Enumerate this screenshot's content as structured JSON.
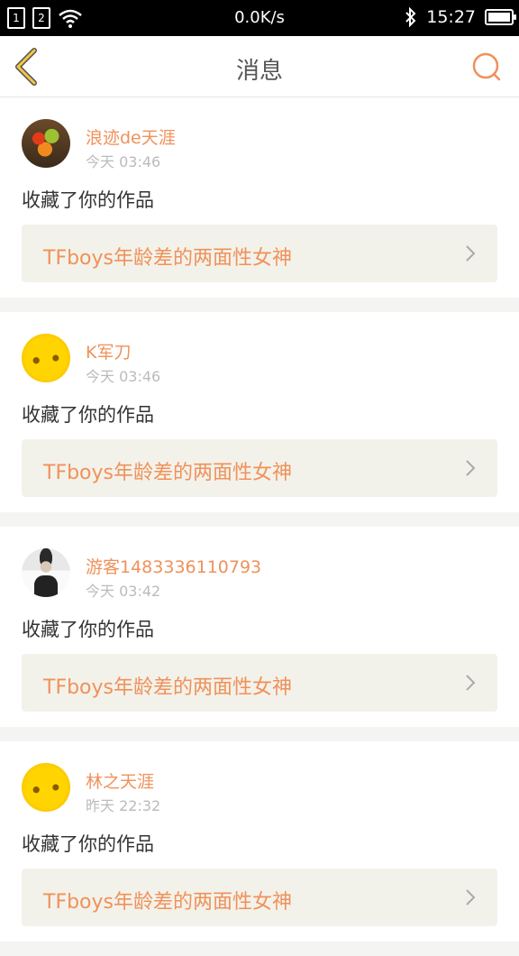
{
  "status_bar": {
    "sim1": "1",
    "sim2": "2",
    "network_speed": "0.0K/s",
    "time": "15:27",
    "icons": [
      "sim-card-icon",
      "wifi-icon",
      "bluetooth-icon",
      "battery-icon"
    ]
  },
  "nav": {
    "title": "消息",
    "back_icon": "chevron-left-icon",
    "search_icon": "search-icon"
  },
  "colors": {
    "accent": "#f0915a",
    "back_icon": "#f5c842"
  },
  "messages": [
    {
      "username": "浪迹de天涯",
      "time": "今天 03:46",
      "action": "收藏了你的作品",
      "work": "TFboys年龄差的两面性女神",
      "avatar": "autumn-leaves-avatar"
    },
    {
      "username": "K军刀",
      "time": "今天 03:46",
      "action": "收藏了你的作品",
      "work": "TFboys年龄差的两面性女神",
      "avatar": "sunflower-avatar"
    },
    {
      "username": "游客1483336110793",
      "time": "今天 03:42",
      "action": "收藏了你的作品",
      "work": "TFboys年龄差的两面性女神",
      "avatar": "person-avatar"
    },
    {
      "username": "林之天涯",
      "time": "昨天 22:32",
      "action": "收藏了你的作品",
      "work": "TFboys年龄差的两面性女神",
      "avatar": "sunflower-avatar"
    }
  ]
}
